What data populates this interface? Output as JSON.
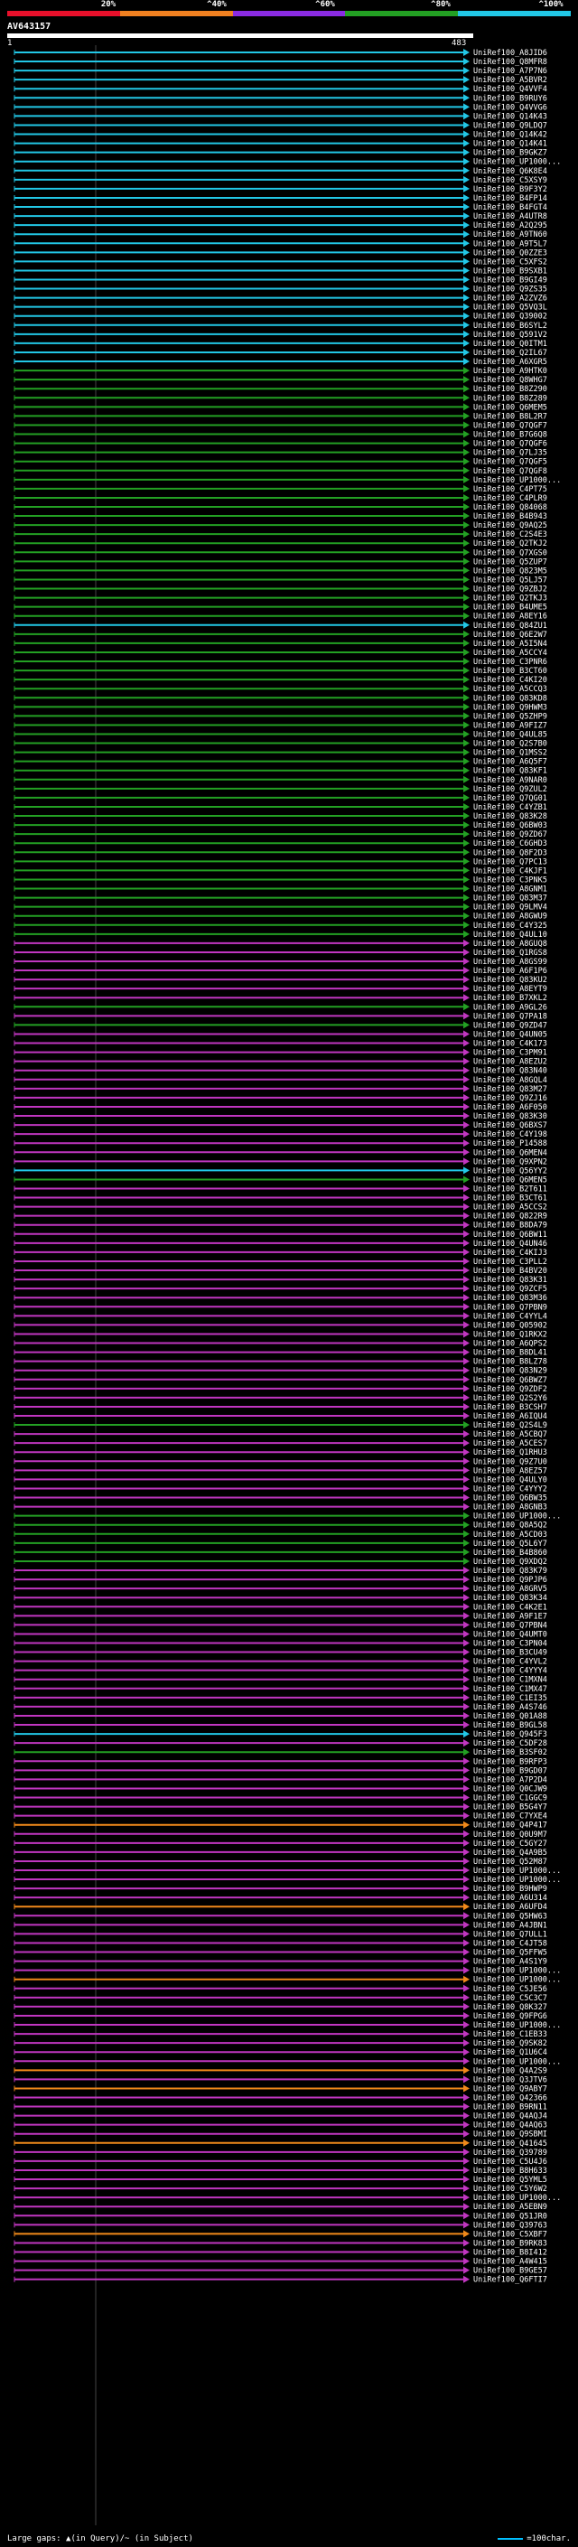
{
  "scale": {
    "labels": [
      "20%",
      "^40%",
      "^60%",
      "^80%",
      "^100%"
    ],
    "colors": [
      "#e8102b",
      "#f08020",
      "#8a2be2",
      "#23a023",
      "#22c7e6"
    ]
  },
  "query": {
    "title": "AV643157",
    "start": "1",
    "end": "483"
  },
  "colors": {
    "cyan": "#22c7e6",
    "green": "#23a023",
    "magenta": "#c036c0",
    "orange": "#f0891a",
    "white": "#ffffff"
  },
  "hits": [
    {
      "label": "UniRef100_A8JID6",
      "color": "cyan"
    },
    {
      "label": "UniRef100_Q8MFR8",
      "color": "cyan"
    },
    {
      "label": "UniRef100_A7P7N6",
      "color": "cyan"
    },
    {
      "label": "UniRef100_A5BVR2",
      "color": "cyan"
    },
    {
      "label": "UniRef100_Q4VVF4",
      "color": "cyan"
    },
    {
      "label": "UniRef100_B9RUY6",
      "color": "cyan"
    },
    {
      "label": "UniRef100_Q4VVG6",
      "color": "cyan"
    },
    {
      "label": "UniRef100_Q14K43",
      "color": "cyan"
    },
    {
      "label": "UniRef100_Q9LDQ7",
      "color": "cyan"
    },
    {
      "label": "UniRef100_Q14K42",
      "color": "cyan"
    },
    {
      "label": "UniRef100_Q14K41",
      "color": "cyan"
    },
    {
      "label": "UniRef100_B9GKZ7",
      "color": "cyan"
    },
    {
      "label": "UniRef100_UP1000...",
      "color": "cyan"
    },
    {
      "label": "UniRef100_Q6K8E4",
      "color": "cyan"
    },
    {
      "label": "UniRef100_C5XSY9",
      "color": "cyan"
    },
    {
      "label": "UniRef100_B9F3Y2",
      "color": "cyan"
    },
    {
      "label": "UniRef100_B4FP14",
      "color": "cyan"
    },
    {
      "label": "UniRef100_B4FGT4",
      "color": "cyan"
    },
    {
      "label": "UniRef100_A4UTR8",
      "color": "cyan"
    },
    {
      "label": "UniRef100_A2Q295",
      "color": "cyan"
    },
    {
      "label": "UniRef100_A9TN60",
      "color": "cyan"
    },
    {
      "label": "UniRef100_A9T5L7",
      "color": "cyan"
    },
    {
      "label": "UniRef100_Q0ZZE3",
      "color": "cyan"
    },
    {
      "label": "UniRef100_C5XFS2",
      "color": "cyan"
    },
    {
      "label": "UniRef100_B9SXB1",
      "color": "cyan"
    },
    {
      "label": "UniRef100_B9GI49",
      "color": "cyan"
    },
    {
      "label": "UniRef100_Q9ZS35",
      "color": "cyan"
    },
    {
      "label": "UniRef100_A2ZVZ6",
      "color": "cyan"
    },
    {
      "label": "UniRef100_Q5VQ3L",
      "color": "cyan"
    },
    {
      "label": "UniRef100_Q39002",
      "color": "cyan"
    },
    {
      "label": "UniRef100_B6SYL2",
      "color": "cyan"
    },
    {
      "label": "UniRef100_Q591V2",
      "color": "cyan"
    },
    {
      "label": "UniRef100_Q0ITM1",
      "color": "cyan"
    },
    {
      "label": "UniRef100_Q2IL67",
      "color": "cyan"
    },
    {
      "label": "UniRef100_A6XGR5",
      "color": "cyan"
    },
    {
      "label": "UniRef100_A9HTK0",
      "color": "green"
    },
    {
      "label": "UniRef100_Q8WHG7",
      "color": "green"
    },
    {
      "label": "UniRef100_B8Z290",
      "color": "green"
    },
    {
      "label": "UniRef100_B8Z289",
      "color": "green"
    },
    {
      "label": "UniRef100_Q6MEM5",
      "color": "green"
    },
    {
      "label": "UniRef100_B8L2R7",
      "color": "green"
    },
    {
      "label": "UniRef100_Q7QGF7",
      "color": "green"
    },
    {
      "label": "UniRef100_B7G6Q8",
      "color": "green"
    },
    {
      "label": "UniRef100_Q7QGF6",
      "color": "green"
    },
    {
      "label": "UniRef100_Q7LJ35",
      "color": "green"
    },
    {
      "label": "UniRef100_Q7QGF5",
      "color": "green"
    },
    {
      "label": "UniRef100_Q7QGF8",
      "color": "green"
    },
    {
      "label": "UniRef100_UP1000...",
      "color": "green"
    },
    {
      "label": "UniRef100_C4PT75",
      "color": "green"
    },
    {
      "label": "UniRef100_C4PLR9",
      "color": "green"
    },
    {
      "label": "UniRef100_Q84068",
      "color": "green"
    },
    {
      "label": "UniRef100_B4B943",
      "color": "green"
    },
    {
      "label": "UniRef100_Q9AQ25",
      "color": "green"
    },
    {
      "label": "UniRef100_C2S4E3",
      "color": "green"
    },
    {
      "label": "UniRef100_Q2TKJ2",
      "color": "green"
    },
    {
      "label": "UniRef100_Q7XGS0",
      "color": "green"
    },
    {
      "label": "UniRef100_Q5ZUP7",
      "color": "green"
    },
    {
      "label": "UniRef100_Q823M5",
      "color": "green"
    },
    {
      "label": "UniRef100_Q5LJ57",
      "color": "green"
    },
    {
      "label": "UniRef100_Q9ZBJ2",
      "color": "green"
    },
    {
      "label": "UniRef100_Q2TKJ3",
      "color": "green"
    },
    {
      "label": "UniRef100_B4UME5",
      "color": "green"
    },
    {
      "label": "UniRef100_A8EY16",
      "color": "green"
    },
    {
      "label": "UniRef100_Q84ZU1",
      "color": "cyan"
    },
    {
      "label": "UniRef100_Q6E2W7",
      "color": "green"
    },
    {
      "label": "UniRef100_A5I5N4",
      "color": "green"
    },
    {
      "label": "UniRef100_A5CCY4",
      "color": "green"
    },
    {
      "label": "UniRef100_C3PNR6",
      "color": "green"
    },
    {
      "label": "UniRef100_B3CT60",
      "color": "green"
    },
    {
      "label": "UniRef100_C4KI20",
      "color": "green"
    },
    {
      "label": "UniRef100_A5CCQ3",
      "color": "green"
    },
    {
      "label": "UniRef100_Q83KD8",
      "color": "green"
    },
    {
      "label": "UniRef100_Q9HWM3",
      "color": "green"
    },
    {
      "label": "UniRef100_Q5ZHP9",
      "color": "green"
    },
    {
      "label": "UniRef100_A9FIZ7",
      "color": "green"
    },
    {
      "label": "UniRef100_Q4UL85",
      "color": "green"
    },
    {
      "label": "UniRef100_Q2S7B0",
      "color": "green"
    },
    {
      "label": "UniRef100_Q1MSS2",
      "color": "green"
    },
    {
      "label": "UniRef100_A6Q5F7",
      "color": "green"
    },
    {
      "label": "UniRef100_Q83KF1",
      "color": "green"
    },
    {
      "label": "UniRef100_A9NAR0",
      "color": "green"
    },
    {
      "label": "UniRef100_Q9ZUL2",
      "color": "green"
    },
    {
      "label": "UniRef100_Q7QG01",
      "color": "green"
    },
    {
      "label": "UniRef100_C4YZB1",
      "color": "green"
    },
    {
      "label": "UniRef100_Q83K28",
      "color": "green"
    },
    {
      "label": "UniRef100_Q6BW03",
      "color": "green"
    },
    {
      "label": "UniRef100_Q9ZD67",
      "color": "green"
    },
    {
      "label": "UniRef100_C6GHD3",
      "color": "green"
    },
    {
      "label": "UniRef100_Q8F2D3",
      "color": "green"
    },
    {
      "label": "UniRef100_Q7PC13",
      "color": "green"
    },
    {
      "label": "UniRef100_C4KJF1",
      "color": "green"
    },
    {
      "label": "UniRef100_C3PNK5",
      "color": "green"
    },
    {
      "label": "UniRef100_A8GNM1",
      "color": "green"
    },
    {
      "label": "UniRef100_Q83M37",
      "color": "green"
    },
    {
      "label": "UniRef100_Q9LMV4",
      "color": "green"
    },
    {
      "label": "UniRef100_A8GWU9",
      "color": "green"
    },
    {
      "label": "UniRef100_C4Y325",
      "color": "green"
    },
    {
      "label": "UniRef100_Q4UL10",
      "color": "green"
    },
    {
      "label": "UniRef100_A8GUQ8",
      "color": "magenta"
    },
    {
      "label": "UniRef100_Q1RGS8",
      "color": "magenta"
    },
    {
      "label": "UniRef100_A8GS99",
      "color": "magenta"
    },
    {
      "label": "UniRef100_A6F1P6",
      "color": "magenta"
    },
    {
      "label": "UniRef100_Q83KU2",
      "color": "magenta"
    },
    {
      "label": "UniRef100_A8EYT9",
      "color": "magenta"
    },
    {
      "label": "UniRef100_B7XKL2",
      "color": "magenta"
    },
    {
      "label": "UniRef100_A9GL26",
      "color": "green"
    },
    {
      "label": "UniRef100_Q7PA18",
      "color": "magenta"
    },
    {
      "label": "UniRef100_Q9ZD47",
      "color": "green"
    },
    {
      "label": "UniRef100_Q4UN05",
      "color": "magenta"
    },
    {
      "label": "UniRef100_C4K173",
      "color": "magenta"
    },
    {
      "label": "UniRef100_C3PM91",
      "color": "magenta"
    },
    {
      "label": "UniRef100_A8EZU2",
      "color": "magenta"
    },
    {
      "label": "UniRef100_Q83N40",
      "color": "magenta"
    },
    {
      "label": "UniRef100_A8GQL4",
      "color": "magenta"
    },
    {
      "label": "UniRef100_Q83M27",
      "color": "magenta"
    },
    {
      "label": "UniRef100_Q9ZJ16",
      "color": "magenta"
    },
    {
      "label": "UniRef100_A6F050",
      "color": "magenta"
    },
    {
      "label": "UniRef100_Q83K30",
      "color": "magenta"
    },
    {
      "label": "UniRef100_Q6BXS7",
      "color": "magenta"
    },
    {
      "label": "UniRef100_C4Y198",
      "color": "magenta"
    },
    {
      "label": "UniRef100_P14588",
      "color": "magenta"
    },
    {
      "label": "UniRef100_Q6MEN4",
      "color": "magenta"
    },
    {
      "label": "UniRef100_Q9XPN2",
      "color": "magenta"
    },
    {
      "label": "UniRef100_Q56YY2",
      "color": "cyan"
    },
    {
      "label": "UniRef100_Q6MEN5",
      "color": "green"
    },
    {
      "label": "UniRef100_B2T611",
      "color": "magenta"
    },
    {
      "label": "UniRef100_B3CT61",
      "color": "magenta"
    },
    {
      "label": "UniRef100_A5CCS2",
      "color": "magenta"
    },
    {
      "label": "UniRef100_Q822R9",
      "color": "magenta"
    },
    {
      "label": "UniRef100_B8DA79",
      "color": "magenta"
    },
    {
      "label": "UniRef100_Q6BW11",
      "color": "magenta"
    },
    {
      "label": "UniRef100_Q4UN46",
      "color": "magenta"
    },
    {
      "label": "UniRef100_C4KIJ3",
      "color": "magenta"
    },
    {
      "label": "UniRef100_C3PLL2",
      "color": "magenta"
    },
    {
      "label": "UniRef100_B4BV20",
      "color": "magenta"
    },
    {
      "label": "UniRef100_Q83K31",
      "color": "magenta"
    },
    {
      "label": "UniRef100_Q9ZCF5",
      "color": "magenta"
    },
    {
      "label": "UniRef100_Q83M36",
      "color": "magenta"
    },
    {
      "label": "UniRef100_Q7PBN9",
      "color": "magenta"
    },
    {
      "label": "UniRef100_C4YYL4",
      "color": "magenta"
    },
    {
      "label": "UniRef100_Q05902",
      "color": "magenta"
    },
    {
      "label": "UniRef100_Q1RKX2",
      "color": "magenta"
    },
    {
      "label": "UniRef100_A6QPS2",
      "color": "magenta"
    },
    {
      "label": "UniRef100_B8DL41",
      "color": "magenta"
    },
    {
      "label": "UniRef100_B8LZ78",
      "color": "magenta"
    },
    {
      "label": "UniRef100_Q83N29",
      "color": "magenta"
    },
    {
      "label": "UniRef100_Q6BWZ7",
      "color": "magenta"
    },
    {
      "label": "UniRef100_Q9ZDF2",
      "color": "magenta"
    },
    {
      "label": "UniRef100_Q2S2Y6",
      "color": "magenta"
    },
    {
      "label": "UniRef100_B3CSH7",
      "color": "magenta"
    },
    {
      "label": "UniRef100_A6IQU4",
      "color": "magenta"
    },
    {
      "label": "UniRef100_Q2S4L9",
      "color": "green"
    },
    {
      "label": "UniRef100_A5CBQ7",
      "color": "magenta"
    },
    {
      "label": "UniRef100_A5CES7",
      "color": "magenta"
    },
    {
      "label": "UniRef100_Q1RHU3",
      "color": "magenta"
    },
    {
      "label": "UniRef100_Q9Z7U0",
      "color": "magenta"
    },
    {
      "label": "UniRef100_A8EZ57",
      "color": "magenta"
    },
    {
      "label": "UniRef100_Q4ULY0",
      "color": "magenta"
    },
    {
      "label": "UniRef100_C4YYY2",
      "color": "magenta"
    },
    {
      "label": "UniRef100_Q6BW35",
      "color": "magenta"
    },
    {
      "label": "UniRef100_A8GNB3",
      "color": "magenta"
    },
    {
      "label": "UniRef100_UP1000...",
      "color": "green"
    },
    {
      "label": "UniRef100_Q8A5Q2",
      "color": "green"
    },
    {
      "label": "UniRef100_A5CD03",
      "color": "green"
    },
    {
      "label": "UniRef100_Q5L6Y7",
      "color": "green"
    },
    {
      "label": "UniRef100_B4B860",
      "color": "green"
    },
    {
      "label": "UniRef100_Q9XDQ2",
      "color": "green"
    },
    {
      "label": "UniRef100_Q83K79",
      "color": "magenta"
    },
    {
      "label": "UniRef100_Q9PJP6",
      "color": "magenta"
    },
    {
      "label": "UniRef100_A8GRV5",
      "color": "magenta"
    },
    {
      "label": "UniRef100_Q83K34",
      "color": "magenta"
    },
    {
      "label": "UniRef100_C4K2E1",
      "color": "magenta"
    },
    {
      "label": "UniRef100_A9F1E7",
      "color": "magenta"
    },
    {
      "label": "UniRef100_Q7PBN4",
      "color": "magenta"
    },
    {
      "label": "UniRef100_Q4UMT0",
      "color": "magenta"
    },
    {
      "label": "UniRef100_C3PN04",
      "color": "magenta"
    },
    {
      "label": "UniRef100_B3CU49",
      "color": "magenta"
    },
    {
      "label": "UniRef100_C4YVL2",
      "color": "magenta"
    },
    {
      "label": "UniRef100_C4YYY4",
      "color": "magenta"
    },
    {
      "label": "UniRef100_C1MXN4",
      "color": "magenta"
    },
    {
      "label": "UniRef100_C1MX47",
      "color": "magenta"
    },
    {
      "label": "UniRef100_C1EI35",
      "color": "magenta"
    },
    {
      "label": "UniRef100_A4S746",
      "color": "magenta"
    },
    {
      "label": "UniRef100_Q01A88",
      "color": "magenta"
    },
    {
      "label": "UniRef100_B9GL58",
      "color": "magenta"
    },
    {
      "label": "UniRef100_Q945F3",
      "color": "cyan"
    },
    {
      "label": "UniRef100_C5DF28",
      "color": "magenta"
    },
    {
      "label": "UniRef100_B3SF02",
      "color": "green"
    },
    {
      "label": "UniRef100_B9RFP3",
      "color": "magenta"
    },
    {
      "label": "UniRef100_B9GD07",
      "color": "magenta"
    },
    {
      "label": "UniRef100_A7P2D4",
      "color": "magenta"
    },
    {
      "label": "UniRef100_Q0CJW9",
      "color": "magenta"
    },
    {
      "label": "UniRef100_C1GGC9",
      "color": "magenta"
    },
    {
      "label": "UniRef100_B5G4Y7",
      "color": "magenta"
    },
    {
      "label": "UniRef100_C7YXE4",
      "color": "magenta"
    },
    {
      "label": "UniRef100_Q4P417",
      "color": "orange"
    },
    {
      "label": "UniRef100_Q0U9M7",
      "color": "magenta"
    },
    {
      "label": "UniRef100_C5GY27",
      "color": "magenta"
    },
    {
      "label": "UniRef100_Q4A9B5",
      "color": "magenta"
    },
    {
      "label": "UniRef100_Q52M87",
      "color": "magenta"
    },
    {
      "label": "UniRef100_UP1000...",
      "color": "magenta"
    },
    {
      "label": "UniRef100_UP1000...",
      "color": "magenta"
    },
    {
      "label": "UniRef100_B9HWP9",
      "color": "magenta"
    },
    {
      "label": "UniRef100_A6U314",
      "color": "magenta"
    },
    {
      "label": "UniRef100_A6UFD4",
      "color": "orange"
    },
    {
      "label": "UniRef100_Q5HW63",
      "color": "magenta"
    },
    {
      "label": "UniRef100_A4JBN1",
      "color": "magenta"
    },
    {
      "label": "UniRef100_Q7ULL1",
      "color": "magenta"
    },
    {
      "label": "UniRef100_C4JT58",
      "color": "magenta"
    },
    {
      "label": "UniRef100_Q5FFW5",
      "color": "magenta"
    },
    {
      "label": "UniRef100_A4S1Y9",
      "color": "magenta"
    },
    {
      "label": "UniRef100_UP1000...",
      "color": "magenta"
    },
    {
      "label": "UniRef100_UP1000...",
      "color": "orange"
    },
    {
      "label": "UniRef100_C5JE56",
      "color": "magenta"
    },
    {
      "label": "UniRef100_C5C3C7",
      "color": "magenta"
    },
    {
      "label": "UniRef100_Q8K327",
      "color": "magenta"
    },
    {
      "label": "UniRef100_Q9FPG6",
      "color": "magenta"
    },
    {
      "label": "UniRef100_UP1000...",
      "color": "magenta"
    },
    {
      "label": "UniRef100_C1EB33",
      "color": "magenta"
    },
    {
      "label": "UniRef100_Q9SK82",
      "color": "magenta"
    },
    {
      "label": "UniRef100_Q1U6C4",
      "color": "magenta"
    },
    {
      "label": "UniRef100_UP1000...",
      "color": "magenta"
    },
    {
      "label": "UniRef100_Q4A2S9",
      "color": "orange"
    },
    {
      "label": "UniRef100_Q3JTV6",
      "color": "magenta"
    },
    {
      "label": "UniRef100_Q9ABY7",
      "color": "orange"
    },
    {
      "label": "UniRef100_Q42366",
      "color": "magenta"
    },
    {
      "label": "UniRef100_B9RN11",
      "color": "magenta"
    },
    {
      "label": "UniRef100_Q4AQJ4",
      "color": "magenta"
    },
    {
      "label": "UniRef100_Q4AQ63",
      "color": "magenta"
    },
    {
      "label": "UniRef100_Q9SBMI",
      "color": "magenta"
    },
    {
      "label": "UniRef100_Q41645",
      "color": "orange"
    },
    {
      "label": "UniRef100_Q39789",
      "color": "magenta"
    },
    {
      "label": "UniRef100_C5U4J6",
      "color": "magenta"
    },
    {
      "label": "UniRef100_B8H633",
      "color": "magenta"
    },
    {
      "label": "UniRef100_Q5YML5",
      "color": "magenta"
    },
    {
      "label": "UniRef100_C5Y6W2",
      "color": "magenta"
    },
    {
      "label": "UniRef100_UP1000...",
      "color": "magenta"
    },
    {
      "label": "UniRef100_A5EBN9",
      "color": "magenta"
    },
    {
      "label": "UniRef100_Q51JR0",
      "color": "magenta"
    },
    {
      "label": "UniRef100_Q39763",
      "color": "magenta"
    },
    {
      "label": "UniRef100_C5XBF7",
      "color": "orange"
    },
    {
      "label": "UniRef100_B9RK83",
      "color": "magenta"
    },
    {
      "label": "UniRef100_B8I412",
      "color": "magenta"
    },
    {
      "label": "UniRef100_A4W415",
      "color": "magenta"
    },
    {
      "label": "UniRef100_B9GE57",
      "color": "magenta"
    },
    {
      "label": "UniRef100_Q6FTI7",
      "color": "magenta"
    }
  ],
  "footer": {
    "text": "Large gaps: ▲(in Query)/~ (in Subject)",
    "key": "=100char."
  }
}
